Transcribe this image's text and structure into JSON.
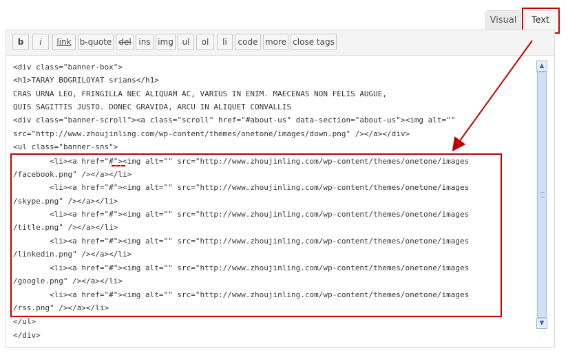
{
  "tabs": {
    "visual": "Visual",
    "text": "Text"
  },
  "toolbar": {
    "buttons": [
      "b",
      "i",
      "link",
      "b-quote",
      "del",
      "ins",
      "img",
      "ul",
      "ol",
      "li",
      "code",
      "more",
      "close tags"
    ]
  },
  "code_lines": [
    "<div class=\"banner-box\">",
    "<h1>TARAY BOGRILOYAT srians</h1>",
    "CRAS URNA LEO, FRINGILLA NEC ALIQUAM AC, VARIUS IN ENIM. MAECENAS NON FELIS AUGUE,",
    "QUIS SAGITTIS JUSTO. DONEC GRAVIDA, ARCU IN ALIQUET CONVALLIS",
    "<div class=\"banner-scroll\"><a class=\"scroll\" href=\"#about-us\" data-section=\"about-us\"><img alt=\"\"",
    "src=\"http://www.zhoujinling.com/wp-content/themes/onetone/images/down.png\" /></a></div>",
    "<ul class=\"banner-sns\">",
    "        <li><a href=\"#\"><img alt=\"\" src=\"http://www.zhoujinling.com/wp-content/themes/onetone/images",
    "/facebook.png\" /></a></li>",
    "        <li><a href=\"#\"><img alt=\"\" src=\"http://www.zhoujinling.com/wp-content/themes/onetone/images",
    "/skype.png\" /></a></li>",
    "        <li><a href=\"#\"><img alt=\"\" src=\"http://www.zhoujinling.com/wp-content/themes/onetone/images",
    "/title.png\" /></a></li>",
    "        <li><a href=\"#\"><img alt=\"\" src=\"http://www.zhoujinling.com/wp-content/themes/onetone/images",
    "/linkedin.png\" /></a></li>",
    "        <li><a href=\"#\"><img alt=\"\" src=\"http://www.zhoujinling.com/wp-content/themes/onetone/images",
    "/google.png\" /></a></li>",
    "        <li><a href=\"#\"><img alt=\"\" src=\"http://www.zhoujinling.com/wp-content/themes/onetone/images",
    "/rss.png\" /></a></li>",
    "</ul>",
    "</div>"
  ],
  "colors": {
    "annotation": "#c00000",
    "scrollbar": "#cfe0f7"
  },
  "icons": {
    "scroll_up": "scroll-up-arrow-icon",
    "scroll_down": "scroll-down-arrow-icon",
    "resize": "resize-grip-icon"
  }
}
